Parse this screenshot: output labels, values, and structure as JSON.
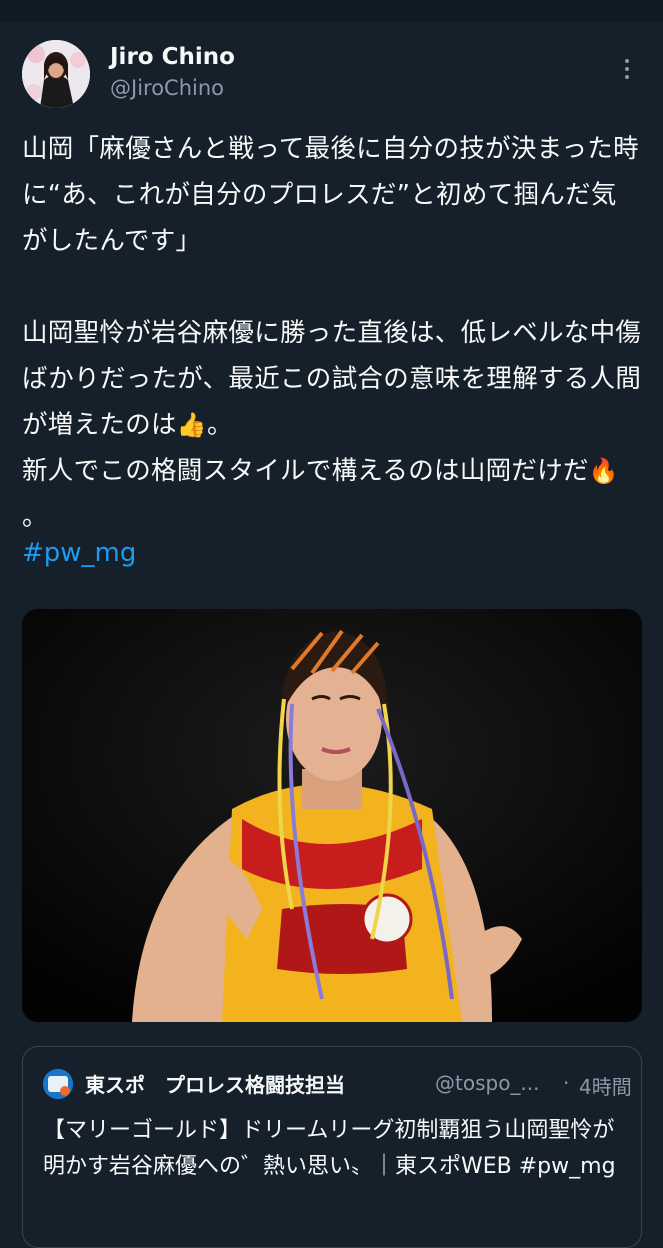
{
  "author": {
    "display_name": "Jiro Chino",
    "handle": "@JiroChino"
  },
  "tweet": {
    "paragraph_1": "山岡「麻優さんと戦って最後に自分の技が決まった時に“あ、これが自分のプロレスだ”と初めて掴んだ気がしたんです」",
    "line_2a": "山岡聖怜が岩谷麻優に勝った直後は、低レベルな中傷ばかりだったが、最近この試合の意味を理解する人間が増えたのは",
    "emoji_thumbs": "👍",
    "line_2a_end": "。",
    "line_2b": "新人でこの格闘スタイルで構えるのは山岡だけだ",
    "emoji_fire": "🔥",
    "line_2b_end": "。",
    "hashtag": "#pw_mg"
  },
  "quote": {
    "name": "東スポ　プロレス格闘技担当",
    "handle": "@tospo_...",
    "separator": "·",
    "time": "4時間",
    "text": "【マリーゴールド】ドリームリーグ初制覇狙う山岡聖怜が明かす岩谷麻優への゛熱い思い〟｜東スポWEB #pw_mg"
  },
  "colors": {
    "background": "#15202b",
    "text": "#f7f9f9",
    "secondary": "#8b98a5",
    "link": "#1d9bf0",
    "border": "#38444d"
  },
  "icons": {
    "more": "more-vertical-icon"
  }
}
